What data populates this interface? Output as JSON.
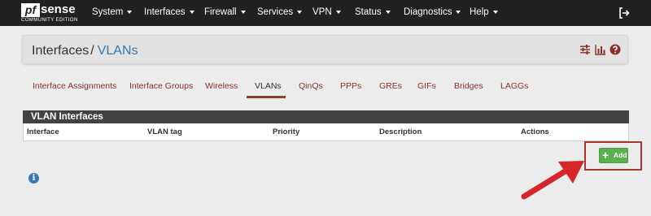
{
  "navbar": {
    "brand": "pfsense",
    "brand_mark": "pf",
    "brand_rest": "sense",
    "edition": "COMMUNITY EDITION",
    "menus": [
      "System",
      "Interfaces",
      "Firewall",
      "Services",
      "VPN",
      "Status",
      "Diagnostics",
      "Help"
    ],
    "logout_icon": "sign-out-icon"
  },
  "breadcrumb": {
    "parent": "Interfaces",
    "separator": "/",
    "current": "VLANs",
    "icons": [
      "sliders-icon",
      "bar-chart-icon",
      "help-icon"
    ]
  },
  "tabs": {
    "items": [
      "Interface Assignments",
      "Interface Groups",
      "Wireless",
      "VLANs",
      "QinQs",
      "PPPs",
      "GREs",
      "GIFs",
      "Bridges",
      "LAGGs"
    ],
    "active": "VLANs"
  },
  "table": {
    "title": "VLAN Interfaces",
    "columns": [
      "Interface",
      "VLAN tag",
      "Priority",
      "Description",
      "Actions"
    ]
  },
  "actions": {
    "add_label": "Add",
    "add_icon": "plus-icon"
  },
  "info_icon": "info-icon",
  "colors": {
    "navbar": "#212121",
    "link": "#8b2f2a",
    "breadcrumb_current": "#3a78b5",
    "panel_heading": "#424242",
    "add_button": "#5bb04f",
    "annotation": "#d8252a"
  }
}
